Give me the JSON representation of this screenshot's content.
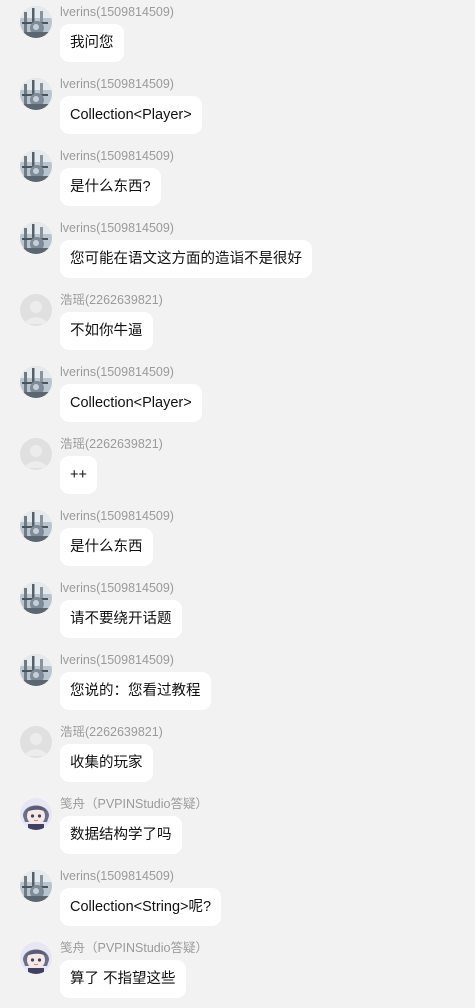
{
  "messages": [
    {
      "sender": "lverins(1509814509)",
      "avatar": "lverins-avatar",
      "text": "我问您"
    },
    {
      "sender": "lverins(1509814509)",
      "avatar": "lverins-avatar",
      "text": "Collection<Player>"
    },
    {
      "sender": "lverins(1509814509)",
      "avatar": "lverins-avatar",
      "text": "是什么东西?"
    },
    {
      "sender": "lverins(1509814509)",
      "avatar": "lverins-avatar",
      "text": "您可能在语文这方面的造诣不是很好"
    },
    {
      "sender": "浩瑶(2262639821)",
      "avatar": "default-avatar",
      "text": "不如你牛逼"
    },
    {
      "sender": "lverins(1509814509)",
      "avatar": "lverins-avatar",
      "text": "Collection<Player>"
    },
    {
      "sender": "浩瑶(2262639821)",
      "avatar": "default-avatar",
      "text": "++"
    },
    {
      "sender": "lverins(1509814509)",
      "avatar": "lverins-avatar",
      "text": "是什么东西"
    },
    {
      "sender": "lverins(1509814509)",
      "avatar": "lverins-avatar",
      "text": "请不要绕开话题"
    },
    {
      "sender": "lverins(1509814509)",
      "avatar": "lverins-avatar",
      "text": "您说的：您看过教程"
    },
    {
      "sender": "浩瑶(2262639821)",
      "avatar": "default-avatar",
      "text": "收集的玩家"
    },
    {
      "sender": "笺舟（PVPINStudio答疑）",
      "avatar": "anime-avatar",
      "text": "数据结构学了吗"
    },
    {
      "sender": "lverins(1509814509)",
      "avatar": "lverins-avatar",
      "text": "Collection<String>呢?"
    },
    {
      "sender": "笺舟（PVPINStudio答疑）",
      "avatar": "anime-avatar",
      "text": "算了 不指望这些"
    }
  ]
}
